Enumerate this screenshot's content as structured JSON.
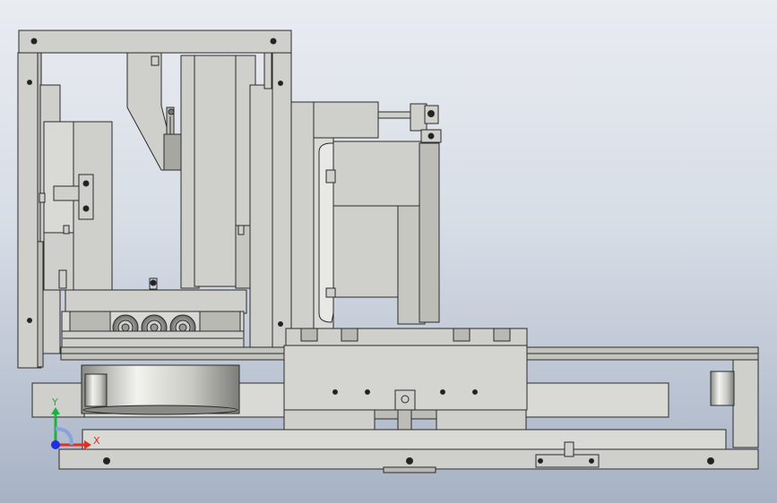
{
  "viewport": {
    "background_top": "#e9ecf1",
    "background_bottom": "#a7b2c4"
  },
  "part_color": "#cfcfcb",
  "edge_color": "#2b2b2b",
  "triad": {
    "x_label": "X",
    "y_label": "Y",
    "x_color": "#e03020",
    "y_color": "#20b040",
    "z_color": "#2030e0"
  }
}
